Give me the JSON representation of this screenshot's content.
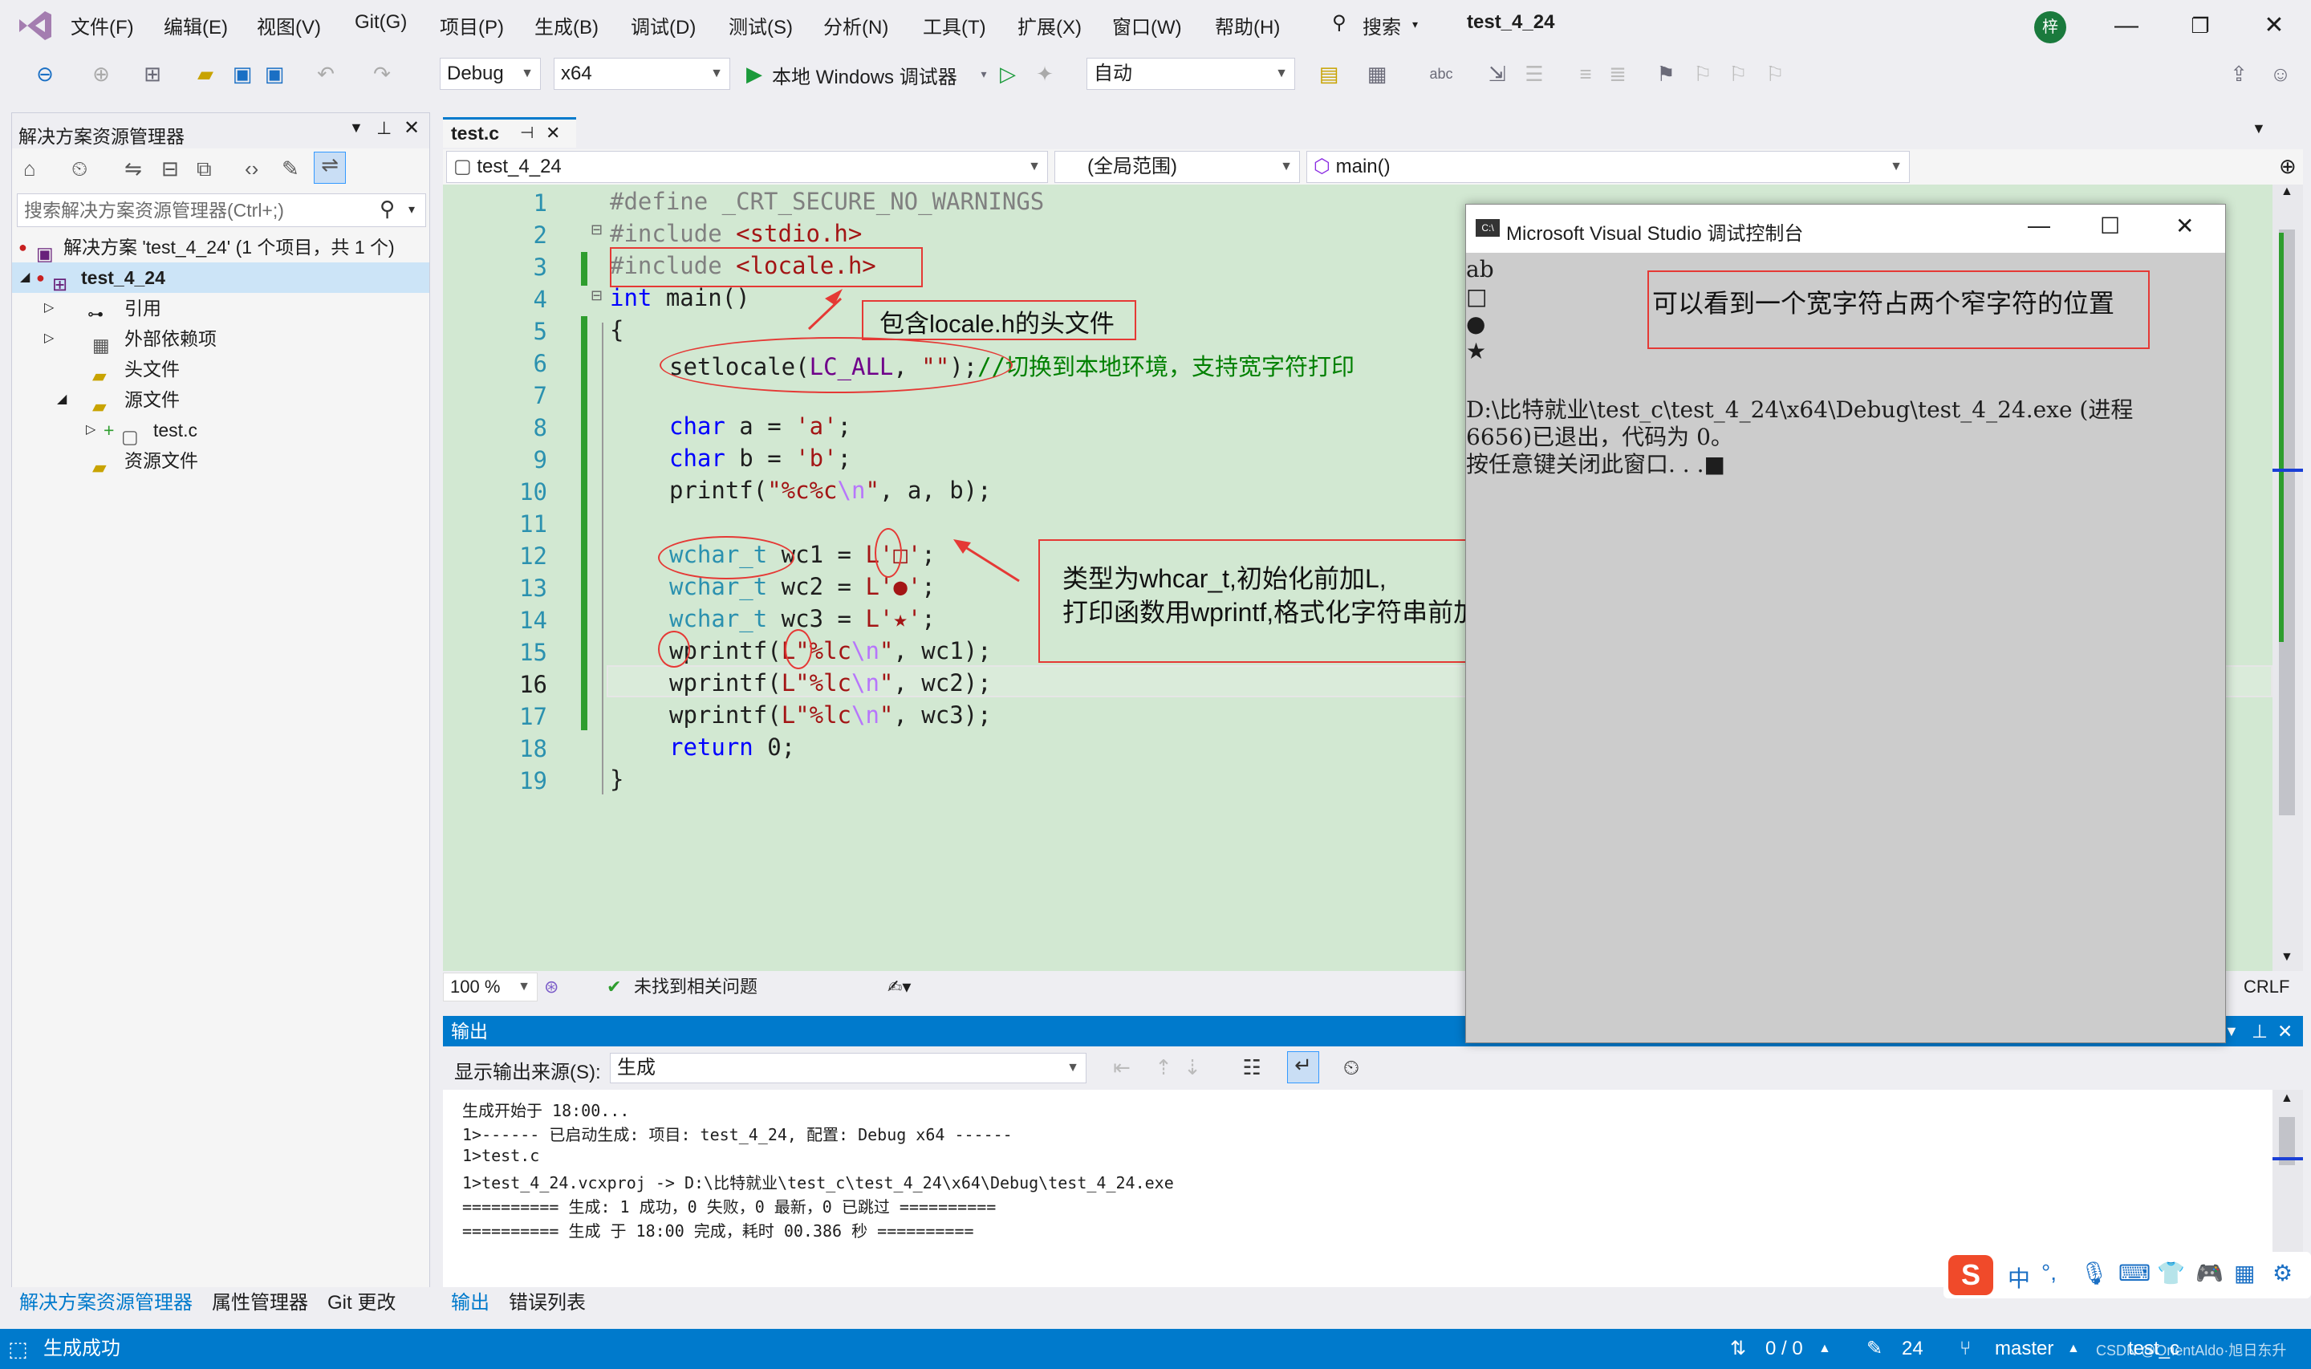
{
  "menubar": {
    "items": [
      "文件(F)",
      "编辑(E)",
      "视图(V)",
      "Git(G)",
      "项目(P)",
      "生成(B)",
      "调试(D)",
      "测试(S)",
      "分析(N)",
      "工具(T)",
      "扩展(X)",
      "窗口(W)",
      "帮助(H)"
    ],
    "search_label": "搜索",
    "solution_name": "test_4_24",
    "avatar_initial": "梓"
  },
  "toolbar": {
    "config": "Debug",
    "platform": "x64",
    "run_label": "本地 Windows 调试器",
    "auto_label": "自动"
  },
  "solution_explorer": {
    "title": "解决方案资源管理器",
    "search_placeholder": "搜索解决方案资源管理器(Ctrl+;)",
    "tree": [
      {
        "label": "解决方案 'test_4_24' (1 个项目，共 1 个)",
        "indent": 0
      },
      {
        "label": "test_4_24",
        "indent": 1
      },
      {
        "label": "引用",
        "indent": 2
      },
      {
        "label": "外部依赖项",
        "indent": 2
      },
      {
        "label": "头文件",
        "indent": 2
      },
      {
        "label": "源文件",
        "indent": 2
      },
      {
        "label": "test.c",
        "indent": 3
      },
      {
        "label": "资源文件",
        "indent": 2
      }
    ],
    "tabs": [
      "解决方案资源管理器",
      "属性管理器",
      "Git 更改"
    ]
  },
  "editor": {
    "tab": "test.c",
    "nav_project": "test_4_24",
    "nav_scope": "(全局范围)",
    "nav_member": "main()",
    "zoom": "100 %",
    "issues": "未找到相关问题",
    "line_ending": "CRLF",
    "current_line": 16,
    "lines": [
      "1",
      "2",
      "3",
      "4",
      "5",
      "6",
      "7",
      "8",
      "9",
      "10",
      "11",
      "12",
      "13",
      "14",
      "15",
      "16",
      "17",
      "18",
      "19"
    ]
  },
  "code": {
    "l1": "#define _CRT_SECURE_NO_WARNINGS",
    "l2a": "#include ",
    "l2b": "<stdio.h>",
    "l3a": "#include ",
    "l3b": "<locale.h>",
    "l4a": "int",
    "l4b": " main()",
    "l5": "{",
    "l6a": "setlocale(",
    "l6b": "LC_ALL",
    "l6c": ", ",
    "l6d": "\"\"",
    "l6e": ");",
    "l6f": "//切换到本地环境，支持宽字符打印",
    "l8a": "char",
    "l8b": " a = ",
    "l8c": "'a'",
    "l8d": ";",
    "l9a": "char",
    "l9b": " b = ",
    "l9c": "'b'",
    "l9d": ";",
    "l10a": "printf(",
    "l10b": "\"%c%c",
    "l10c": "\\n",
    "l10d": "\"",
    "l10e": ", a, b);",
    "l12a": "wchar_t",
    "l12b": " wc1 = ",
    "l12c": "L'□'",
    "l12d": ";",
    "l13a": "wchar_t",
    "l13b": " wc2 = ",
    "l13c": "L'●'",
    "l13d": ";",
    "l14a": "wchar_t",
    "l14b": " wc3 = ",
    "l14c": "L'★'",
    "l14d": ";",
    "l15a": "wprintf(",
    "l15b": "L\"%lc",
    "l15c": "\\n",
    "l15d": "\"",
    "l15e": ", wc1);",
    "l16a": "wprintf(",
    "l16b": "L\"%lc",
    "l16c": "\\n",
    "l16d": "\"",
    "l16e": ", wc2);",
    "l17a": "wprintf(",
    "l17b": "L\"%lc",
    "l17c": "\\n",
    "l17d": "\"",
    "l17e": ", wc3);",
    "l18a": "return",
    "l18b": " 0;",
    "l19": "}"
  },
  "console": {
    "title": "Microsoft Visual Studio 调试控制台",
    "lines": [
      "ab",
      "□",
      "●",
      "★",
      "",
      "D:\\比特就业\\test_c\\test_4_24\\x64\\Debug\\test_4_24.exe (进程",
      "6656)已退出，代码为 0。",
      "按任意键关闭此窗口. . .■"
    ]
  },
  "annotations": {
    "include_note": "包含locale.h的头文件",
    "wide_note": "可以看到一个宽字符占两个窄字符的位置",
    "wchar_note_1": "类型为whcar_t,初始化前加L,",
    "wchar_note_2": "打印函数用wprintf,格式化字符串前加L"
  },
  "output": {
    "title": "输出",
    "source_label": "显示输出来源(S):",
    "source_value": "生成",
    "lines": [
      "生成开始于 18:00...",
      "1>------ 已启动生成: 项目: test_4_24, 配置: Debug x64 ------",
      "1>test.c",
      "1>test_4_24.vcxproj -> D:\\比特就业\\test_c\\test_4_24\\x64\\Debug\\test_4_24.exe",
      "========== 生成: 1 成功，0 失败，0 最新，0 已跳过 ==========",
      "========== 生成 于 18:00 完成，耗时 00.386 秒 =========="
    ],
    "tabs": [
      "输出",
      "错误列表"
    ]
  },
  "statusbar": {
    "build_status": "生成成功",
    "sync": "0 / 0",
    "changes": "24",
    "branch": "master",
    "repo": "test_c",
    "watermark": "CSDN @OrientAldo·旭日东升"
  },
  "ime": {
    "lang": "中"
  }
}
